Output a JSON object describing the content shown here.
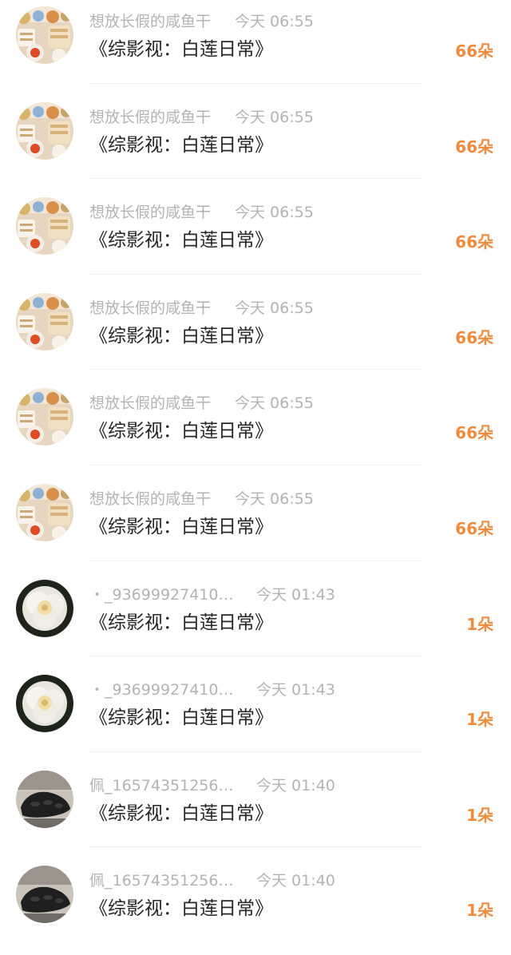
{
  "gift_list": {
    "items": [
      {
        "avatar_icon": "dessert-avatar-icon",
        "user": "想放长假的咸鱼干",
        "time": "今天 06:55",
        "book": "《综影视：白莲日常》",
        "gift": "66朵"
      },
      {
        "avatar_icon": "dessert-avatar-icon",
        "user": "想放长假的咸鱼干",
        "time": "今天 06:55",
        "book": "《综影视：白莲日常》",
        "gift": "66朵"
      },
      {
        "avatar_icon": "dessert-avatar-icon",
        "user": "想放长假的咸鱼干",
        "time": "今天 06:55",
        "book": "《综影视：白莲日常》",
        "gift": "66朵"
      },
      {
        "avatar_icon": "dessert-avatar-icon",
        "user": "想放长假的咸鱼干",
        "time": "今天 06:55",
        "book": "《综影视：白莲日常》",
        "gift": "66朵"
      },
      {
        "avatar_icon": "dessert-avatar-icon",
        "user": "想放长假的咸鱼干",
        "time": "今天 06:55",
        "book": "《综影视：白莲日常》",
        "gift": "66朵"
      },
      {
        "avatar_icon": "dessert-avatar-icon",
        "user": "想放长假的咸鱼干",
        "time": "今天 06:55",
        "book": "《综影视：白莲日常》",
        "gift": "66朵"
      },
      {
        "avatar_icon": "white-rose-avatar-icon",
        "user": "・_93699927410…",
        "time": "今天 01:43",
        "book": "《综影视：白莲日常》",
        "gift": "1朵"
      },
      {
        "avatar_icon": "white-rose-avatar-icon",
        "user": "・_93699927410…",
        "time": "今天 01:43",
        "book": "《综影视：白莲日常》",
        "gift": "1朵"
      },
      {
        "avatar_icon": "black-shoe-avatar-icon",
        "user": "佩_16574351256…",
        "time": "今天 01:40",
        "book": "《综影视：白莲日常》",
        "gift": "1朵"
      },
      {
        "avatar_icon": "black-shoe-avatar-icon",
        "user": "佩_16574351256…",
        "time": "今天 01:40",
        "book": "《综影视：白莲日常》",
        "gift": "1朵"
      }
    ]
  },
  "colors": {
    "username": "#b3b3b3",
    "title": "#262626",
    "gift": "#f08a3c",
    "divider": "#f1f1f1"
  }
}
